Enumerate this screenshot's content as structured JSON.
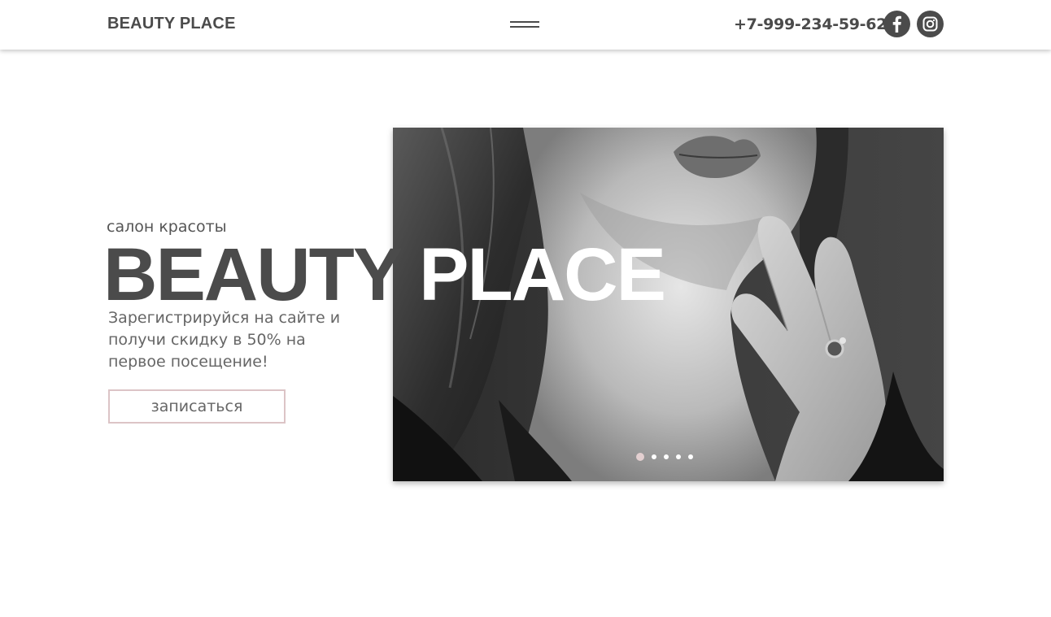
{
  "header": {
    "logo": "BEAUTY PLACE",
    "menu_icon": "hamburger-menu-icon",
    "phone": "+7-999-234-59-62",
    "social": [
      {
        "name": "facebook-icon",
        "glyph": "f"
      },
      {
        "name": "instagram-icon"
      }
    ]
  },
  "hero": {
    "subtitle": "салон красоты",
    "title_dark": "BEAUTY",
    "title_light": "PLACE",
    "promo": "Зарегистрируйся на сайте и получи скидку в 50% на первое посещение!",
    "cta_label": "записаться",
    "slider": {
      "slide_count": 5,
      "active_slide": 1
    }
  },
  "colors": {
    "text_dark": "#4b4b4b",
    "accent_pink": "#dcc4c6",
    "dot_active": "#e3cfd0"
  }
}
